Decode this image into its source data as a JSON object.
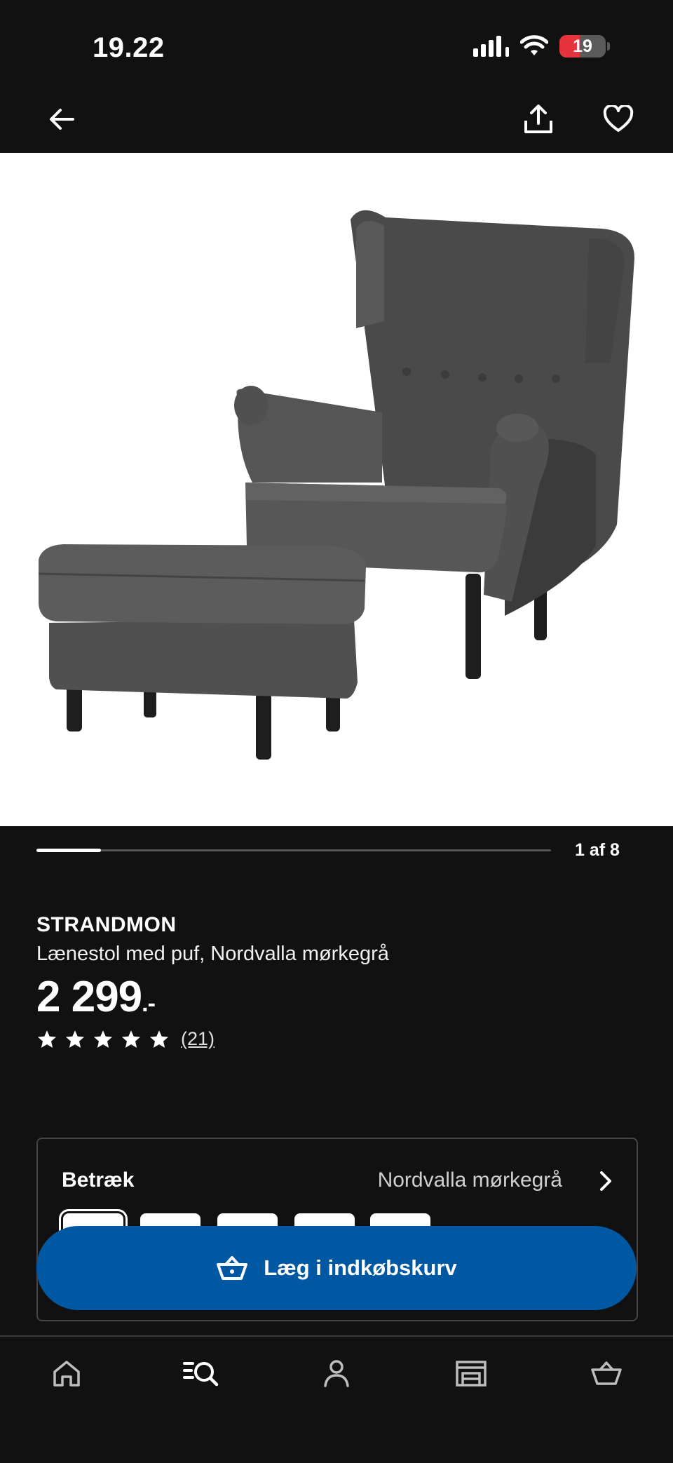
{
  "status_bar": {
    "time": "19.22",
    "battery_level": "19",
    "icons": [
      "cellular-signal-icon",
      "wifi-icon",
      "battery-icon"
    ]
  },
  "nav": {
    "icons": [
      "back-arrow-icon",
      "share-icon",
      "heart-icon"
    ]
  },
  "gallery": {
    "counter": "1 af 8",
    "progress_fraction": 0.125
  },
  "product": {
    "name": "STRANDMON",
    "description": "Lænestol med puf, Nordvalla mørkegrå",
    "price": "2 299",
    "price_suffix": ".-",
    "rating_stars": 5,
    "review_count": "(21)"
  },
  "options": {
    "label": "Betræk",
    "selected_value": "Nordvalla mørkegrå",
    "swatch_count": 5
  },
  "cta": {
    "label": "Læg i indkøbskurv",
    "color": "#0058a3"
  },
  "tab_bar": {
    "tabs": [
      "home-icon",
      "search-icon",
      "profile-icon",
      "store-icon",
      "basket-icon"
    ],
    "active": "search-icon"
  },
  "colors": {
    "background": "#111111",
    "accent": "#0058a3",
    "battery_low": "#e7343a"
  }
}
